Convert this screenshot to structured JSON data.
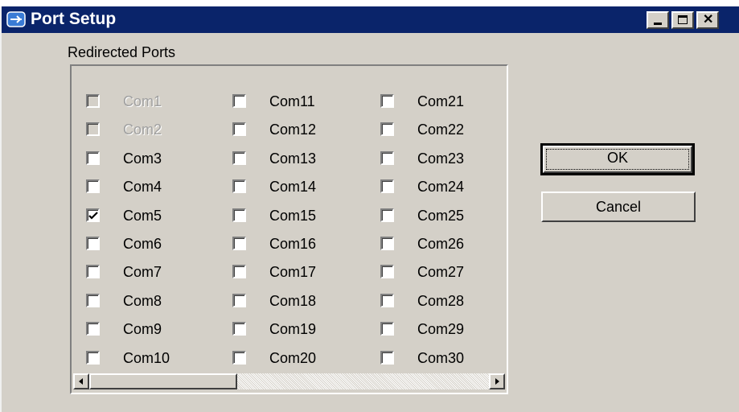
{
  "window": {
    "title": "Port Setup",
    "controls": {
      "minimize": "minimize",
      "maximize": "maximize",
      "close": "close"
    }
  },
  "ports": {
    "group_label": "Redirected Ports",
    "items": [
      {
        "label": "Com1",
        "checked": false,
        "disabled": true
      },
      {
        "label": "Com2",
        "checked": false,
        "disabled": true
      },
      {
        "label": "Com3",
        "checked": false,
        "disabled": false
      },
      {
        "label": "Com4",
        "checked": false,
        "disabled": false
      },
      {
        "label": "Com5",
        "checked": true,
        "disabled": false
      },
      {
        "label": "Com6",
        "checked": false,
        "disabled": false
      },
      {
        "label": "Com7",
        "checked": false,
        "disabled": false
      },
      {
        "label": "Com8",
        "checked": false,
        "disabled": false
      },
      {
        "label": "Com9",
        "checked": false,
        "disabled": false
      },
      {
        "label": "Com10",
        "checked": false,
        "disabled": false
      },
      {
        "label": "Com11",
        "checked": false,
        "disabled": false
      },
      {
        "label": "Com12",
        "checked": false,
        "disabled": false
      },
      {
        "label": "Com13",
        "checked": false,
        "disabled": false
      },
      {
        "label": "Com14",
        "checked": false,
        "disabled": false
      },
      {
        "label": "Com15",
        "checked": false,
        "disabled": false
      },
      {
        "label": "Com16",
        "checked": false,
        "disabled": false
      },
      {
        "label": "Com17",
        "checked": false,
        "disabled": false
      },
      {
        "label": "Com18",
        "checked": false,
        "disabled": false
      },
      {
        "label": "Com19",
        "checked": false,
        "disabled": false
      },
      {
        "label": "Com20",
        "checked": false,
        "disabled": false
      },
      {
        "label": "Com21",
        "checked": false,
        "disabled": false
      },
      {
        "label": "Com22",
        "checked": false,
        "disabled": false
      },
      {
        "label": "Com23",
        "checked": false,
        "disabled": false
      },
      {
        "label": "Com24",
        "checked": false,
        "disabled": false
      },
      {
        "label": "Com25",
        "checked": false,
        "disabled": false
      },
      {
        "label": "Com26",
        "checked": false,
        "disabled": false
      },
      {
        "label": "Com27",
        "checked": false,
        "disabled": false
      },
      {
        "label": "Com28",
        "checked": false,
        "disabled": false
      },
      {
        "label": "Com29",
        "checked": false,
        "disabled": false
      },
      {
        "label": "Com30",
        "checked": false,
        "disabled": false
      }
    ]
  },
  "buttons": {
    "ok": "OK",
    "cancel": "Cancel"
  },
  "colors": {
    "titlebar": "#0a246a",
    "face": "#d4d0c8",
    "title_text": "#ffffff"
  }
}
